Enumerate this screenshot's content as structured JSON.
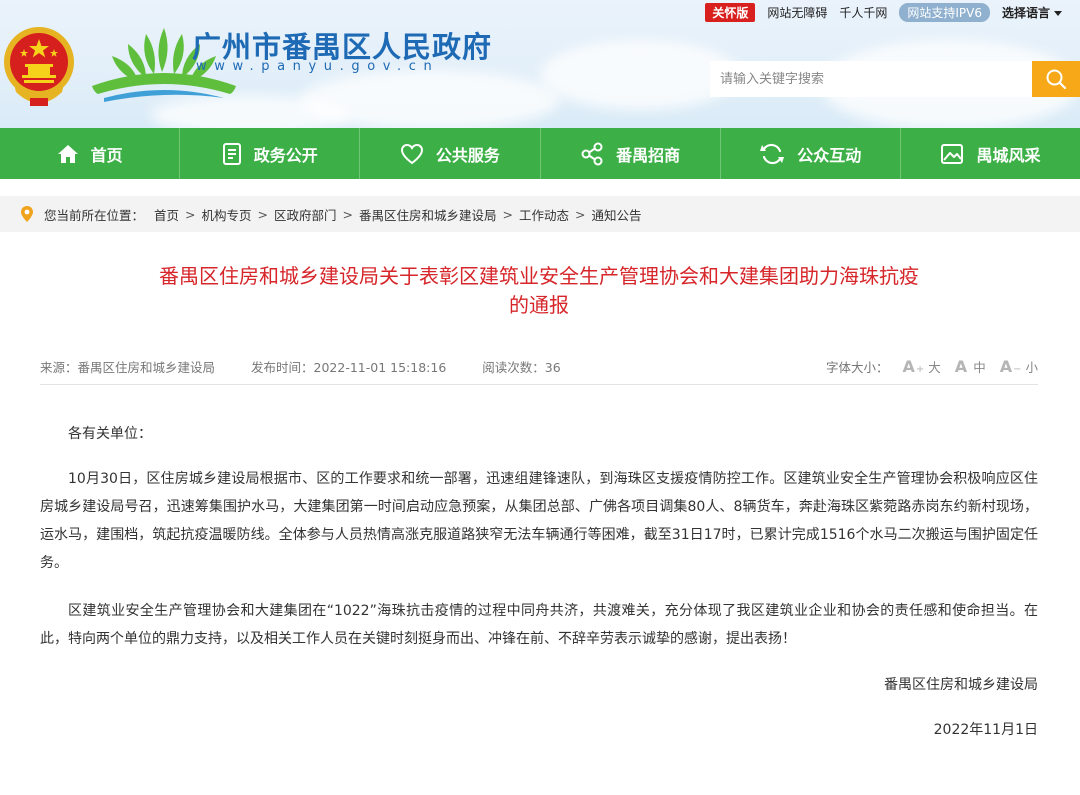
{
  "header": {
    "top_links": {
      "care_mode": "关怀版",
      "accessibility": "网站无障碍",
      "qianren": "千人千网",
      "ipv6": "网站支持IPV6",
      "language": "选择语言"
    },
    "site_name": "广州市番禺区人民政府",
    "site_url": "www.panyu.gov.cn",
    "search": {
      "placeholder": "请输入关键字搜索"
    }
  },
  "nav": {
    "items": [
      {
        "label": "首页",
        "icon": "home-icon"
      },
      {
        "label": "政务公开",
        "icon": "document-icon"
      },
      {
        "label": "公共服务",
        "icon": "heart-icon"
      },
      {
        "label": "番禺招商",
        "icon": "share-icon"
      },
      {
        "label": "公众互动",
        "icon": "refresh-icon"
      },
      {
        "label": "禺城风采",
        "icon": "picture-icon"
      }
    ]
  },
  "breadcrumb": {
    "prefix": "您当前所在位置：",
    "items": [
      "首页",
      "机构专页",
      "区政府部门",
      "番禺区住房和城乡建设局",
      "工作动态",
      "通知公告"
    ],
    "separator": ">"
  },
  "article": {
    "title_line1": "番禺区住房和城乡建设局关于表彰区建筑业安全生产管理协会和大建集团助力海珠抗疫",
    "title_line2": "的通报",
    "meta": {
      "source": "来源：番禺区住房和城乡建设局",
      "publish_time": "发布时间：2022-11-01 15:18:16",
      "views": "阅读次数：36",
      "font_size_label": "字体大小：",
      "font_large": "大",
      "font_medium": "中",
      "font_small": "小"
    },
    "greeting": "各有关单位：",
    "paragraph1": "10月30日，区住房城乡建设局根据市、区的工作要求和统一部署，迅速组建锋速队，到海珠区支援疫情防控工作。区建筑业安全生产管理协会积极响应区住房城乡建设局号召，迅速筹集围护水马，大建集团第一时间启动应急预案，从集团总部、广佛各项目调集80人、8辆货车，奔赴海珠区紫菀路赤岗东约新村现场，运水马，建围档，筑起抗疫温暖防线。全体参与人员热情高涨克服道路狭窄无法车辆通行等困难，截至31日17时，已累计完成1516个水马二次搬运与围护固定任务。",
    "paragraph2": "区建筑业安全生产管理协会和大建集团在“1022”海珠抗击疫情的过程中同舟共济，共渡难关，充分体现了我区建筑业企业和协会的责任感和使命担当。在此，特向两个单位的鼎力支持，以及相关工作人员在关键时刻挺身而出、冲锋在前、不辞辛劳表示诚挚的感谢，提出表扬！",
    "signature_org": "番禺区住房和城乡建设局",
    "signature_date": "2022年11月1日"
  },
  "colors": {
    "nav_green": "#3cb046",
    "title_red": "#d6262a",
    "search_button": "#f7a818",
    "care_red": "#d8201f",
    "brand_blue": "#1e6ab5"
  }
}
